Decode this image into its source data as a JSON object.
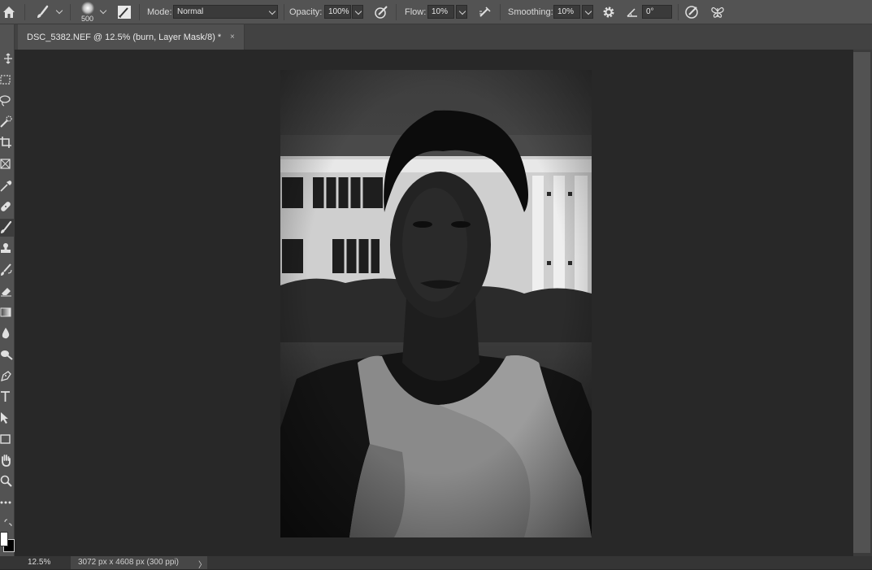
{
  "options_bar": {
    "brush_size": "500",
    "mode_label": "Mode:",
    "mode_value": "Normal",
    "opacity_label": "Opacity:",
    "opacity_value": "100%",
    "flow_label": "Flow:",
    "flow_value": "10%",
    "smoothing_label": "Smoothing:",
    "smoothing_value": "10%",
    "angle_value": "0°"
  },
  "document_tab": {
    "title": "DSC_5382.NEF @ 12.5% (burn, Layer Mask/8) *",
    "close": "×"
  },
  "toolbar": {
    "tools": [
      "move-tool",
      "marquee-tool",
      "lasso-tool",
      "quick-selection-tool",
      "crop-tool",
      "frame-tool",
      "eyedropper-tool",
      "healing-brush-tool",
      "brush-tool",
      "clone-stamp-tool",
      "history-brush-tool",
      "eraser-tool",
      "gradient-tool",
      "blur-tool",
      "dodge-burn-tool",
      "pen-tool",
      "type-tool",
      "path-selection-tool",
      "rectangle-tool",
      "hand-tool",
      "zoom-tool",
      "more-tools"
    ],
    "active_tool": "brush-tool"
  },
  "status_bar": {
    "zoom": "12.5%",
    "document_info": "3072 px x 4608 px (300 ppi)",
    "arrow": "〉"
  },
  "colors": {
    "panel": "#535353",
    "canvas": "#282828",
    "tab": "#505050",
    "foreground_swatch": "#ffffff",
    "background_swatch": "#000000"
  }
}
